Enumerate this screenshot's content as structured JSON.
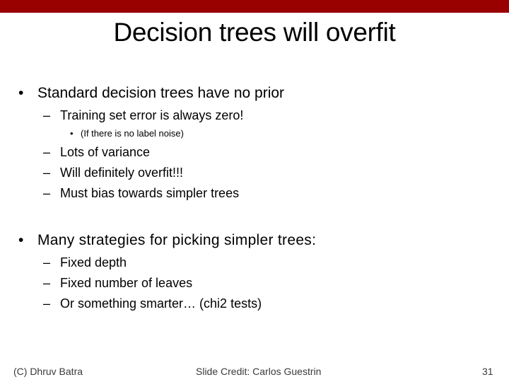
{
  "slide": {
    "title": "Decision trees will overfit",
    "bullet_glyph": "•",
    "dash_glyph": "–",
    "sections": [
      {
        "text": "Standard decision trees have no prior",
        "sub": [
          {
            "text": "Training set error is always zero!",
            "sub": [
              {
                "text": "(If there is no label noise)"
              }
            ]
          },
          {
            "text": "Lots of variance"
          },
          {
            "text": "Will definitely overfit!!!"
          },
          {
            "text": "Must bias towards simpler trees"
          }
        ]
      },
      {
        "text": "Many strategies for picking simpler trees:",
        "sub": [
          {
            "text": "Fixed depth"
          },
          {
            "text": "Fixed number of leaves"
          },
          {
            "text": "Or something smarter… (chi2 tests)"
          }
        ]
      }
    ],
    "footer": {
      "left": "(C) Dhruv Batra",
      "center": "Slide Credit: Carlos Guestrin",
      "page_number": "31"
    },
    "colors": {
      "accent_bar": "#990000"
    }
  }
}
